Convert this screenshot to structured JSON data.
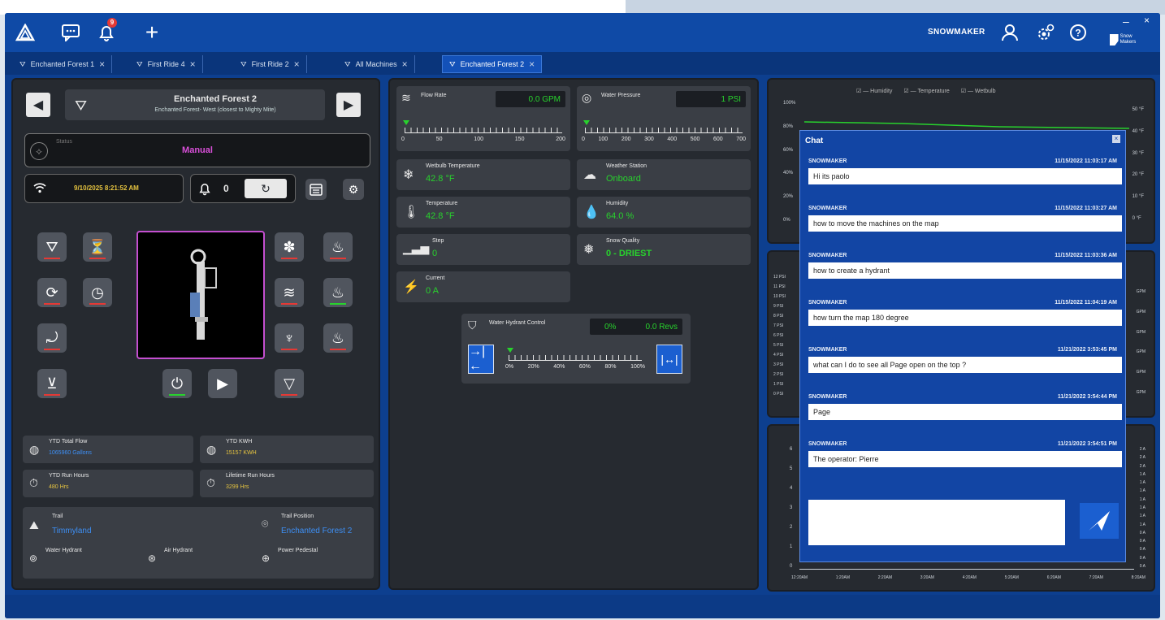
{
  "topbar": {
    "notif_count": "9",
    "username": "SNOWMAKER",
    "logo_text": "Snow Makers"
  },
  "tabs": [
    {
      "label": "Enchanted Forest 1"
    },
    {
      "label": "First Ride 4"
    },
    {
      "label": "First Ride 2"
    },
    {
      "label": "All Machines"
    },
    {
      "label": "Enchanted Forest 2"
    }
  ],
  "machine": {
    "name": "Enchanted Forest 2",
    "subtitle": "Enchanted Forest- West (closest to Mighty Mite)",
    "status_label": "Status",
    "status_value": "Manual",
    "timestamp": "9/10/2025 8:21:52 AM",
    "alarm_count": "0"
  },
  "stats": {
    "ytd_flow_label": "YTD Total Flow",
    "ytd_flow_value": "1065960 Gallons",
    "ytd_kwh_label": "YTD KWH",
    "ytd_kwh_value": "15157 KWH",
    "ytd_run_label": "YTD Run Hours",
    "ytd_run_value": "480 Hrs",
    "life_run_label": "Lifetime Run Hours",
    "life_run_value": "3299 Hrs"
  },
  "trail": {
    "trail_label": "Trail",
    "trail_value": "Timmyland",
    "position_label": "Trail Position",
    "position_value": "Enchanted Forest 2",
    "water_hydrant": "Water Hydrant",
    "air_hydrant": "Air Hydrant",
    "power_pedestal": "Power Pedestal"
  },
  "sensors": {
    "flow_label": "Flow Rate",
    "flow_value": "0.0 GPM",
    "flow_ticks": [
      "0",
      "50",
      "100",
      "150",
      "200"
    ],
    "pressure_label": "Water Pressure",
    "pressure_value": "1 PSI",
    "pressure_ticks": [
      "0",
      "100",
      "200",
      "300",
      "400",
      "500",
      "600",
      "700"
    ],
    "wetbulb_label": "Wetbulb Temperature",
    "wetbulb_value": "42.8 °F",
    "weather_label": "Weather Station",
    "weather_value": "Onboard",
    "temp_label": "Temperature",
    "temp_value": "42.8 °F",
    "humidity_label": "Humidity",
    "humidity_value": "64.0 %",
    "step_label": "Step",
    "step_value": "0",
    "quality_label": "Snow Quality",
    "quality_value": "0 - DRIEST",
    "current_label": "Current",
    "current_value": "0 A"
  },
  "hydrant": {
    "label": "Water Hydrant Control",
    "percent": "0%",
    "revs": "0.0 Revs",
    "ticks": [
      "0%",
      "20%",
      "40%",
      "60%",
      "80%",
      "100%"
    ]
  },
  "chart": {
    "legend": [
      "Humidity",
      "Temperature",
      "Wetbulb"
    ],
    "left_ticks_top": [
      "100%",
      "80%",
      "60%",
      "40%",
      "20%",
      "0%"
    ],
    "right_ticks_top": [
      "50 °F",
      "40 °F",
      "30 °F",
      "20 °F",
      "10 °F",
      "0 °F"
    ],
    "left_ticks_mid": [
      "12 PSI",
      "11 PSI",
      "10 PSI",
      "9 PSI",
      "8 PSI",
      "7 PSI",
      "6 PSI",
      "5 PSI",
      "4 PSI",
      "3 PSI",
      "2 PSI",
      "1 PSI",
      "0 PSI"
    ],
    "right_ticks_mid": [
      "GPM",
      "GPM",
      "GPM",
      "GPM",
      "GPM",
      "GPM"
    ],
    "left_ticks_bot": [
      "6",
      "5",
      "4",
      "3",
      "2",
      "1",
      "0"
    ],
    "right_ticks_bot": [
      "2 A",
      "2 A",
      "2 A",
      "1 A",
      "1 A",
      "1 A",
      "1 A",
      "1 A",
      "1 A",
      "1 A",
      "0 A",
      "0 A",
      "0 A",
      "0 A",
      "0 A"
    ],
    "x_ticks": [
      "12:20AM",
      "1:20AM",
      "2:20AM",
      "3:20AM",
      "4:20AM",
      "5:20AM",
      "6:20AM",
      "7:20AM",
      "8:20AM"
    ]
  },
  "chat": {
    "title": "Chat",
    "messages": [
      {
        "user": "SNOWMAKER",
        "time": "11/15/2022 11:03:17 AM",
        "text": "Hi its paolo"
      },
      {
        "user": "SNOWMAKER",
        "time": "11/15/2022 11:03:27 AM",
        "text": "how to move the machines on the map"
      },
      {
        "user": "SNOWMAKER",
        "time": "11/15/2022 11:03:36 AM",
        "text": "how to create a hydrant"
      },
      {
        "user": "SNOWMAKER",
        "time": "11/15/2022 11:04:19 AM",
        "text": "how turn the map 180 degree"
      },
      {
        "user": "SNOWMAKER",
        "time": "11/21/2022 3:53:45 PM",
        "text": "what can I do to see all Page open on the top ?"
      },
      {
        "user": "SNOWMAKER",
        "time": "11/21/2022 3:54:44 PM",
        "text": "Page"
      },
      {
        "user": "SNOWMAKER",
        "time": "11/21/2022 3:54:51 PM",
        "text": "The operator: Pierre"
      }
    ]
  }
}
